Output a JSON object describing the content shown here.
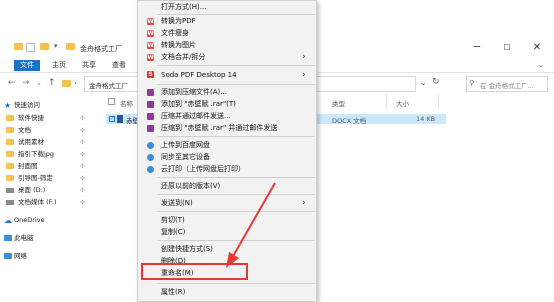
{
  "window": {
    "title": "金舟格式工厂",
    "tabs": [
      "文件",
      "主页",
      "共享",
      "查看"
    ],
    "address": "金舟格式工厂",
    "search_placeholder": "在 金舟格式工厂...",
    "controls": {
      "minimize": "─",
      "maximize": "☐",
      "close": "✕"
    }
  },
  "nav": {
    "items": [
      {
        "label": "快速访问",
        "icon": "star-icon"
      },
      {
        "label": "软件快捷",
        "icon": "folder-icon"
      },
      {
        "label": "文档",
        "icon": "folder-icon"
      },
      {
        "label": "试用素材",
        "icon": "folder-icon"
      },
      {
        "label": "指引下载jpg",
        "icon": "folder-icon"
      },
      {
        "label": "封面图",
        "icon": "folder-icon"
      },
      {
        "label": "引导图-筛定",
        "icon": "folder-icon"
      },
      {
        "label": "桌面 (D:)",
        "icon": "drive-icon"
      },
      {
        "label": "文档媒体 (F:)",
        "icon": "drive-icon"
      },
      {
        "label": "OneDrive",
        "icon": "cloud-icon"
      },
      {
        "label": "此电脑",
        "icon": "computer-icon"
      },
      {
        "label": "网络",
        "icon": "network-icon"
      }
    ]
  },
  "list": {
    "headers": [
      "名称",
      "类型",
      "大小"
    ],
    "rows": [
      {
        "name": "赤壁",
        "type": "DOCX 文档",
        "size": "14 KB"
      }
    ]
  },
  "menu": {
    "items": [
      {
        "label": "打开方式(H)...",
        "icon": "",
        "arrow": false
      },
      {
        "label": "转换为PDF",
        "icon": "w-icon",
        "arrow": false
      },
      {
        "label": "文件瘦身",
        "icon": "w-icon",
        "arrow": false
      },
      {
        "label": "转换为图片",
        "icon": "w-icon",
        "arrow": false
      },
      {
        "label": "文档合并/拆分",
        "icon": "w-icon",
        "arrow": true
      },
      {
        "label": "Soda PDF Desktop 14",
        "icon": "soda-icon",
        "arrow": true
      },
      {
        "label": "添加到压缩文件(A)...",
        "icon": "rar-icon",
        "arrow": false
      },
      {
        "label": "添加到 \"赤壁赋 .rar\"(T)",
        "icon": "rar-icon",
        "arrow": false
      },
      {
        "label": "压缩并通过邮件发送...",
        "icon": "rar-icon",
        "arrow": false
      },
      {
        "label": "压缩到 \"赤壁赋 .rar\" 并通过邮件发送",
        "icon": "rar-icon",
        "arrow": false
      },
      {
        "label": "上传到百度网盘",
        "icon": "baidu-icon",
        "arrow": false
      },
      {
        "label": "同步至其它设备",
        "icon": "baidu-icon",
        "arrow": false
      },
      {
        "label": "云打印（上传网盘后打印）",
        "icon": "baidu-icon",
        "arrow": false
      },
      {
        "label": "还原以前的版本(V)",
        "icon": "",
        "arrow": false
      },
      {
        "label": "发送到(N)",
        "icon": "",
        "arrow": true
      },
      {
        "label": "剪切(T)",
        "icon": "",
        "arrow": false
      },
      {
        "label": "复制(C)",
        "icon": "",
        "arrow": false
      },
      {
        "label": "创建快捷方式(S)",
        "icon": "",
        "arrow": false
      },
      {
        "label": "删除(D)",
        "icon": "",
        "arrow": false
      },
      {
        "label": "重命名(M)",
        "icon": "",
        "arrow": false
      },
      {
        "label": "属性(R)",
        "icon": "",
        "arrow": false
      }
    ]
  },
  "colors": {
    "accent": "#1a73c6",
    "highlight": "#e53935",
    "menu_bg": "#f2f2f2",
    "selection": "#cce8ff"
  }
}
